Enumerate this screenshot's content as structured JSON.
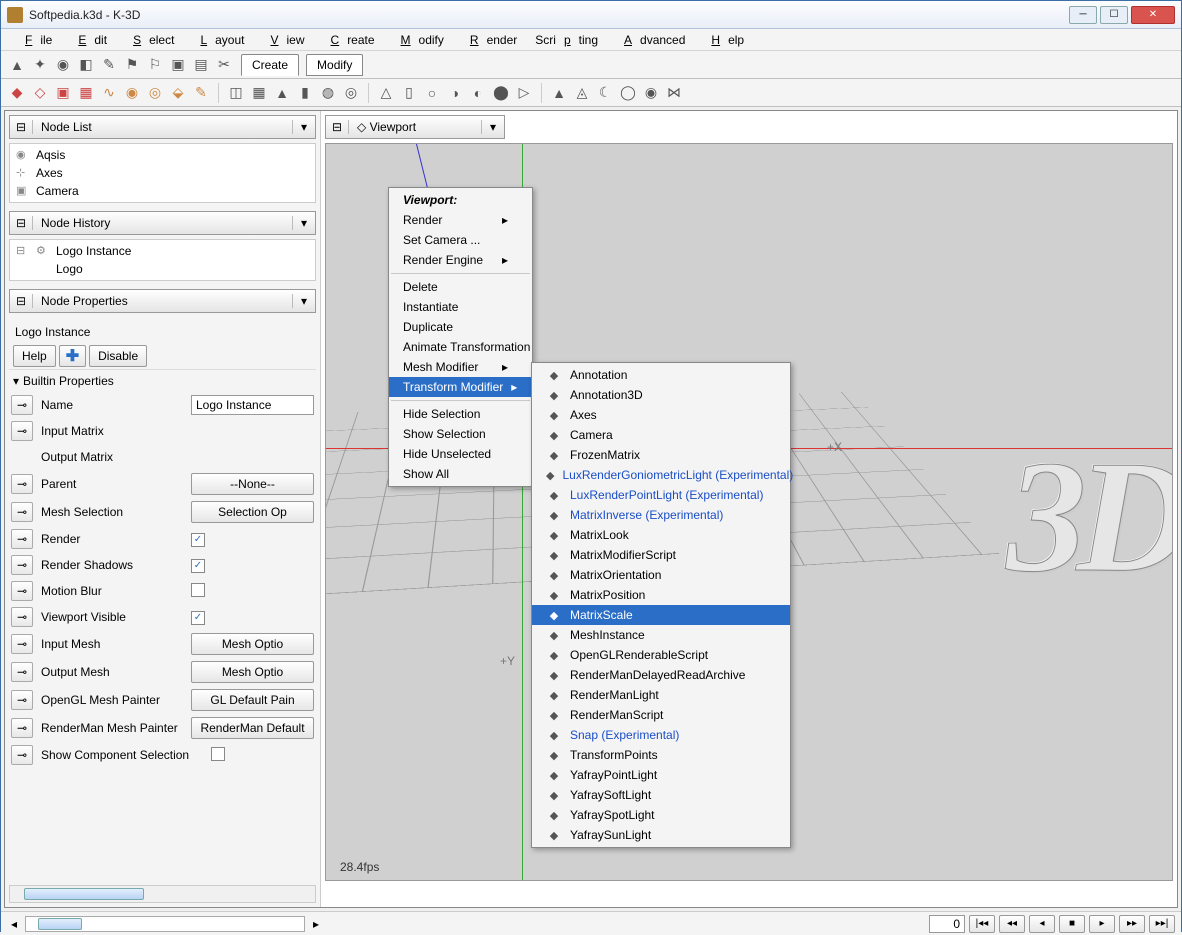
{
  "window": {
    "title": "Softpedia.k3d - K-3D"
  },
  "menubar": [
    "File",
    "Edit",
    "Select",
    "Layout",
    "View",
    "Create",
    "Modify",
    "Render",
    "Scripting",
    "Advanced",
    "Help"
  ],
  "toolbar_tabs": {
    "create": "Create",
    "modify": "Modify"
  },
  "panels": {
    "nodelist": {
      "title": "Node List",
      "items": [
        "Aqsis",
        "Axes",
        "Camera"
      ]
    },
    "nodehistory": {
      "title": "Node History",
      "items": [
        "Logo Instance",
        "Logo"
      ]
    },
    "nodeprops": {
      "title": "Node Properties",
      "instance_label": "Logo Instance",
      "buttons": {
        "help": "Help",
        "disable": "Disable"
      },
      "section": "Builtin Properties",
      "rows": {
        "name": {
          "label": "Name",
          "value": "Logo Instance"
        },
        "input_matrix": {
          "label": "Input Matrix"
        },
        "output_matrix": {
          "label": "Output Matrix"
        },
        "parent": {
          "label": "Parent",
          "btn": "--None--"
        },
        "mesh_selection": {
          "label": "Mesh Selection",
          "btn": "Selection Op"
        },
        "render": {
          "label": "Render",
          "checked": true
        },
        "render_shadows": {
          "label": "Render Shadows",
          "checked": true
        },
        "motion_blur": {
          "label": "Motion Blur",
          "checked": false
        },
        "viewport_visible": {
          "label": "Viewport Visible",
          "checked": true
        },
        "input_mesh": {
          "label": "Input Mesh",
          "btn": "Mesh Optio"
        },
        "output_mesh": {
          "label": "Output Mesh",
          "btn": "Mesh Optio"
        },
        "opengl_painter": {
          "label": "OpenGL Mesh Painter",
          "btn": "GL Default Pain"
        },
        "renderman_painter": {
          "label": "RenderMan Mesh Painter",
          "btn": "RenderMan Default"
        },
        "show_comp_sel": {
          "label": "Show Component Selection",
          "checked": false
        }
      }
    }
  },
  "viewport": {
    "title": "Viewport",
    "fps": "28.4fps",
    "x_label": "+X",
    "y_label": "+Y"
  },
  "context_menu_1": {
    "head": "Viewport:",
    "items": [
      {
        "label": "Render",
        "arrow": true
      },
      {
        "label": "Set Camera ..."
      },
      {
        "label": "Render Engine",
        "arrow": true
      },
      {
        "sep": true
      },
      {
        "label": "Delete"
      },
      {
        "label": "Instantiate"
      },
      {
        "label": "Duplicate"
      },
      {
        "label": "Animate Transformation"
      },
      {
        "label": "Mesh Modifier",
        "arrow": true
      },
      {
        "label": "Transform Modifier",
        "arrow": true,
        "hover": true
      },
      {
        "sep": true
      },
      {
        "label": "Hide Selection"
      },
      {
        "label": "Show Selection"
      },
      {
        "label": "Hide Unselected"
      },
      {
        "label": "Show All"
      }
    ]
  },
  "context_menu_2": [
    {
      "label": "Annotation"
    },
    {
      "label": "Annotation3D"
    },
    {
      "label": "Axes"
    },
    {
      "label": "Camera"
    },
    {
      "label": "FrozenMatrix"
    },
    {
      "label": "LuxRenderGoniometricLight (Experimental)",
      "blue": true
    },
    {
      "label": "LuxRenderPointLight (Experimental)",
      "blue": true
    },
    {
      "label": "MatrixInverse (Experimental)",
      "blue": true
    },
    {
      "label": "MatrixLook"
    },
    {
      "label": "MatrixModifierScript"
    },
    {
      "label": "MatrixOrientation"
    },
    {
      "label": "MatrixPosition"
    },
    {
      "label": "MatrixScale",
      "hover": true
    },
    {
      "label": "MeshInstance"
    },
    {
      "label": "OpenGLRenderableScript"
    },
    {
      "label": "RenderManDelayedReadArchive"
    },
    {
      "label": "RenderManLight"
    },
    {
      "label": "RenderManScript"
    },
    {
      "label": "Snap (Experimental)",
      "blue": true
    },
    {
      "label": "TransformPoints"
    },
    {
      "label": "YafrayPointLight"
    },
    {
      "label": "YafraySoftLight"
    },
    {
      "label": "YafraySpotLight"
    },
    {
      "label": "YafraySunLight"
    }
  ],
  "status": {
    "frame": "0"
  }
}
